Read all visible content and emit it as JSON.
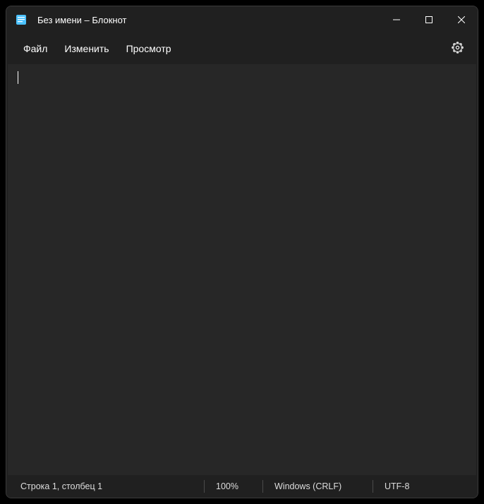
{
  "title": "Без имени – Блокнот",
  "menu": {
    "file": "Файл",
    "edit": "Изменить",
    "view": "Просмотр"
  },
  "editor": {
    "content": ""
  },
  "status": {
    "position": "Строка 1, столбец 1",
    "zoom": "100%",
    "lineEnding": "Windows (CRLF)",
    "encoding": "UTF-8"
  }
}
